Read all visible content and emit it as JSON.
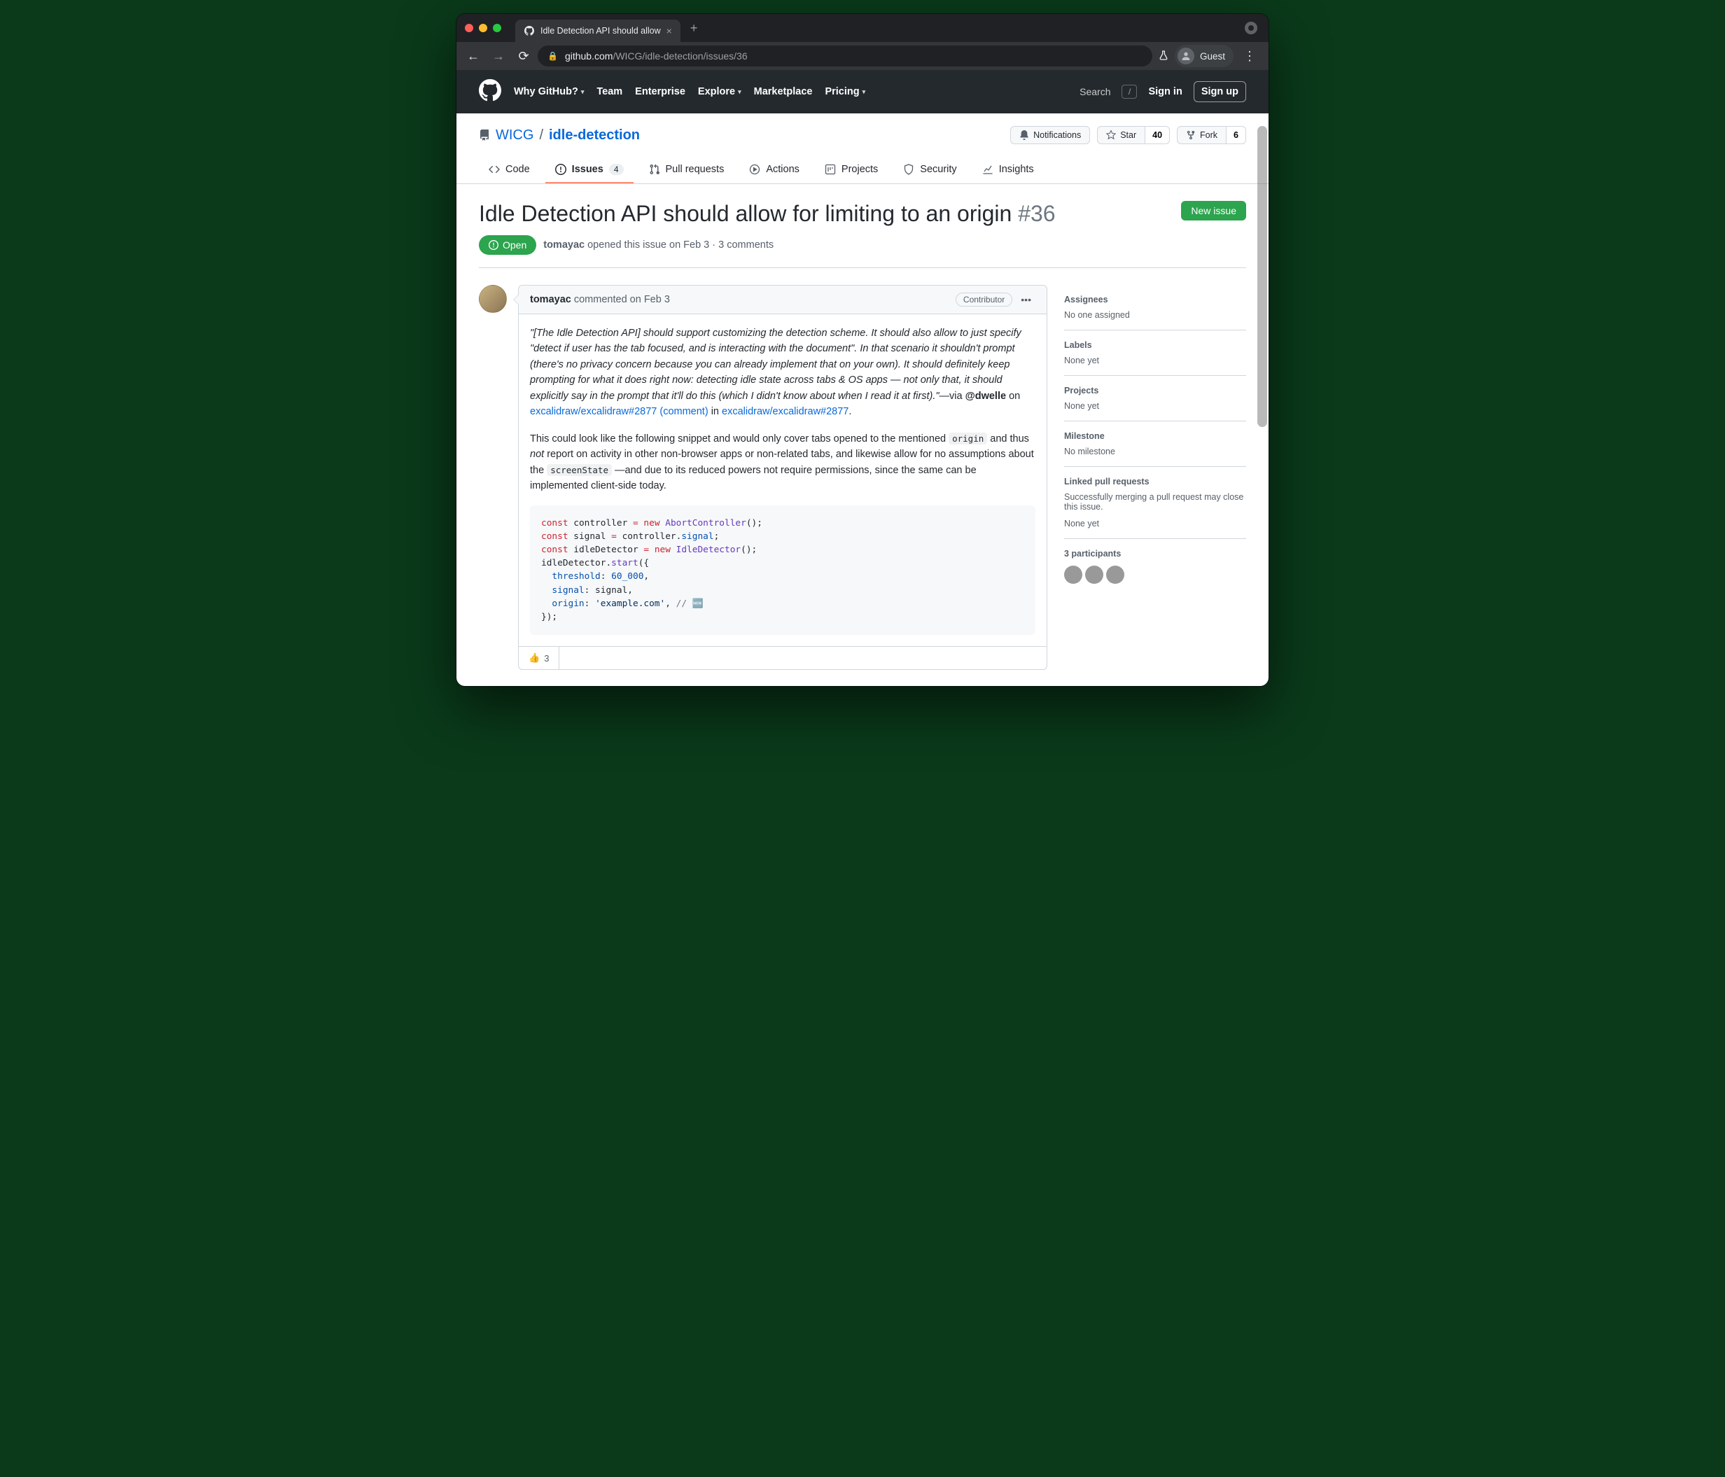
{
  "browser": {
    "tab_title": "Idle Detection API should allow",
    "url_host": "github.com",
    "url_path": "/WICG/idle-detection/issues/36",
    "guest_label": "Guest"
  },
  "gh_header": {
    "nav": [
      "Why GitHub?",
      "Team",
      "Enterprise",
      "Explore",
      "Marketplace",
      "Pricing"
    ],
    "search": "Search",
    "slash": "/",
    "signin": "Sign in",
    "signup": "Sign up"
  },
  "repo": {
    "owner": "WICG",
    "name": "idle-detection",
    "notifications": "Notifications",
    "star": "Star",
    "star_count": "40",
    "fork": "Fork",
    "fork_count": "6",
    "tabs": {
      "code": "Code",
      "issues": "Issues",
      "issues_count": "4",
      "pulls": "Pull requests",
      "actions": "Actions",
      "projects": "Projects",
      "security": "Security",
      "insights": "Insights"
    }
  },
  "issue": {
    "title": "Idle Detection API should allow for limiting to an origin",
    "number": "#36",
    "new_issue": "New issue",
    "state": "Open",
    "author": "tomayac",
    "opened": " opened this issue on Feb 3 · 3 comments"
  },
  "comment": {
    "author": "tomayac",
    "time": " commented on Feb 3",
    "badge": "Contributor",
    "quote": "\"[The Idle Detection API] should support customizing the detection scheme. It should also allow to just specify \"detect if user has the tab focused, and is interacting with the document\". In that scenario it shouldn't prompt (there's no privacy concern because you can already implement that on your own). It should definitely keep prompting for what it does right now: detecting idle state across tabs & OS apps — not only that, it should explicitly say in the prompt that it'll do this (which I didn't know about when I read it at first).\"",
    "via": "—via ",
    "via_handle": "@dwelle",
    "via_on": " on ",
    "link1": "excalidraw/excalidraw#2877 (comment)",
    "in": " in ",
    "link2": "excalidraw/excalidraw#2877",
    "p2a": "This could look like the following snippet and would only cover tabs opened to the mentioned ",
    "code_origin": "origin",
    "p2b": " and thus ",
    "not": "not",
    "p2c": " report on activity in other non-browser apps or non-related tabs, and likewise allow for no assumptions about the ",
    "code_screen": "screenState",
    "p2d": " —and due to its reduced powers not require permissions, since the same can be implemented client-side today.",
    "reaction_count": "3"
  },
  "code": {
    "l1a": "const",
    "l1b": " controller ",
    "l1c": "=",
    "l1d": " new",
    "l1e": " AbortController",
    "l1f": "();",
    "l2a": "const",
    "l2b": " signal ",
    "l2c": "=",
    "l2d": " controller.",
    "l2e": "signal",
    "l2f": ";",
    "l3a": "const",
    "l3b": " idleDetector ",
    "l3c": "=",
    "l3d": " new",
    "l3e": " IdleDetector",
    "l3f": "();",
    "l4a": "idleDetector.",
    "l4b": "start",
    "l4c": "({",
    "l5a": "  threshold",
    "l5b": ": ",
    "l5c": "60_000",
    "l5d": ",",
    "l6a": "  signal",
    "l6b": ": signal,",
    "l7a": "  origin",
    "l7b": ": ",
    "l7c": "'example.com'",
    "l7d": ", ",
    "l7e": "// 🆕",
    "l8": "});"
  },
  "sidebar": {
    "assignees_h": "Assignees",
    "assignees_v": "No one assigned",
    "labels_h": "Labels",
    "labels_v": "None yet",
    "projects_h": "Projects",
    "projects_v": "None yet",
    "milestone_h": "Milestone",
    "milestone_v": "No milestone",
    "linked_h": "Linked pull requests",
    "linked_desc": "Successfully merging a pull request may close this issue.",
    "linked_v": "None yet",
    "participants_h": "3 participants"
  }
}
